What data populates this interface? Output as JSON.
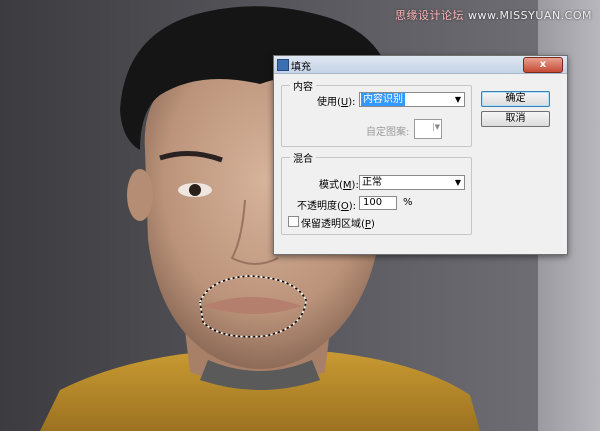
{
  "watermark": {
    "brand": "思缘设计论坛",
    "site": "www.MISSYUAN.COM"
  },
  "dialog": {
    "title": "填充",
    "close_glyph": "x",
    "ok_label": "确定",
    "cancel_label": "取消",
    "content_group": {
      "title": "内容",
      "use_label": "使用(",
      "use_key": "U",
      "use_label_end": "):",
      "use_value": "内容识别",
      "custom_pattern_label": "自定图案:"
    },
    "blend_group": {
      "title": "混合",
      "mode_label": "模式(",
      "mode_key": "M",
      "mode_label_end": "):",
      "mode_value": "正常",
      "opacity_label": "不透明度(",
      "opacity_key": "O",
      "opacity_label_end": "):",
      "opacity_value": "100",
      "opacity_unit": "%",
      "preserve_label": "保留透明区域(",
      "preserve_key": "P",
      "preserve_label_end": ")",
      "preserve_checked": false
    }
  },
  "colors": {
    "selection_highlight": "#3399ff",
    "sweater": "#b8892a",
    "skin": "#c29a80"
  }
}
